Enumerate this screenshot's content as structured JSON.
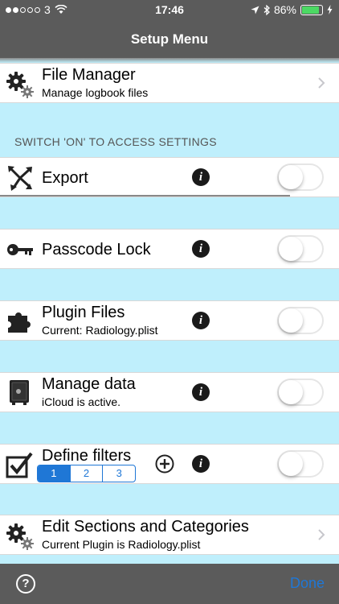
{
  "status_bar": {
    "carrier": "3",
    "time": "17:46",
    "battery_percent": "86%",
    "battery_level": 0.86,
    "signal_dots_filled": 2,
    "signal_dots_total": 5
  },
  "nav": {
    "title": "Setup Menu"
  },
  "rows": {
    "file_manager": {
      "title": "File Manager",
      "subtitle": "Manage logbook files",
      "icon": "gears-icon"
    },
    "section_header": "SWITCH 'ON' TO ACCESS SETTINGS",
    "export": {
      "title": "Export",
      "icon": "export-arrows-icon",
      "enabled": false
    },
    "passcode": {
      "title": "Passcode Lock",
      "icon": "key-icon",
      "enabled": false
    },
    "plugin": {
      "title": "Plugin Files",
      "subtitle": "Current: Radiology.plist",
      "icon": "puzzle-icon",
      "enabled": false
    },
    "manage_data": {
      "title": "Manage data",
      "subtitle": "iCloud is active.",
      "icon": "safe-icon",
      "enabled": false
    },
    "filters": {
      "title": "Define filters",
      "icon": "checkbox-icon",
      "segments": [
        "1",
        "2",
        "3"
      ],
      "selected_segment": 0,
      "enabled": false
    },
    "edit_sections": {
      "title": "Edit Sections and Categories",
      "subtitle": "Current Plugin is Radiology.plist",
      "icon": "gears-icon"
    }
  },
  "info_glyph": "i",
  "toolbar": {
    "help_label": "?",
    "done_label": "Done"
  },
  "colors": {
    "bar": "#5b5b5b",
    "background": "#bfeffc",
    "accent": "#1f77d6",
    "battery": "#4cd964"
  }
}
